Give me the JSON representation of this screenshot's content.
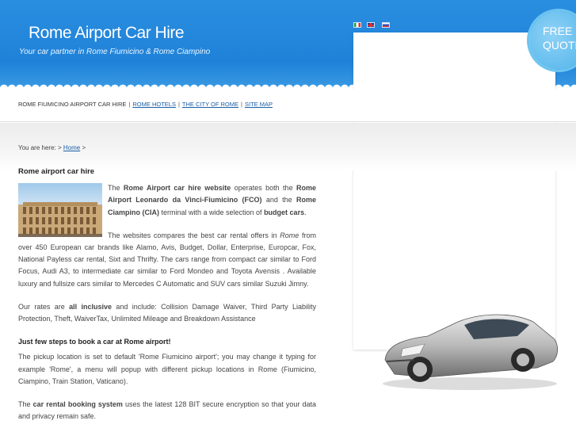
{
  "header": {
    "title": "Rome Airport Car Hire",
    "tagline": "Your car partner in Rome Fiumicino & Rome Ciampino",
    "quote_line1": "FREE",
    "quote_line2": "QUOTE"
  },
  "nav": {
    "item1": "ROME FIUMICINO AIRPORT CAR HIRE",
    "item2": "ROME HOTELS",
    "item3": "THE CITY OF ROME",
    "item4": "SITE MAP",
    "separator": "|"
  },
  "breadcrumb": {
    "prefix": "You are here: >",
    "home": "Home",
    "suffix": ">"
  },
  "main": {
    "heading": "Rome airport car hire",
    "p1": {
      "t1": "The ",
      "b1": "Rome Airport car hire website",
      "t2": " operates both the ",
      "b2": "Rome Airport Leonardo da Vinci-Fiumicino (FCO)",
      "t3": " and the ",
      "b3": "Rome Ciampino (CIA)",
      "t4": " terminal with a wide selection of ",
      "b4": "budget cars",
      "t5": "."
    },
    "p2": {
      "t1": "The websites compares the best car rental offers in ",
      "i1": "Rome",
      "t2": " from over 450 European car brands like Alamo, Avis, Budget, Dollar, Enterprise, Europcar, Fox, National Payless car rental, Sixt and Thrifty. The cars range from compact car similar to Ford Focus, Audi A3, to intermediate car similar to Ford Mondeo and Toyota Avensis . Available luxury and fullsize cars similar to Mercedes C Automatic and SUV cars similar Suzuki Jimny."
    },
    "p3": {
      "t1": "Our rates are ",
      "b1": "all inclusive",
      "t2": " and include: Collision Damage Waiver, Third Party Liability Protection, Theft, WaiverTax, Unlimited Mileage and Breakdown Assistance"
    },
    "subheading": "Just few steps to book a car at Rome airport!",
    "p4": "The pickup location is set to default 'Rome Fiumicino airport'; you may change it typing for example 'Rome', a menu will popup with different pickup locations in Rome (Fiumicino, Ciampino, Train Station, Vaticano).",
    "p5": {
      "t1": "The ",
      "b1": "car rental booking system",
      "t2": " uses the latest 128 BIT secure encryption so that your data and privacy remain safe."
    }
  },
  "colors": {
    "header_blue": "#1f82d8",
    "link_blue": "#1a5fa8",
    "badge_blue": "#4fb3ea"
  }
}
